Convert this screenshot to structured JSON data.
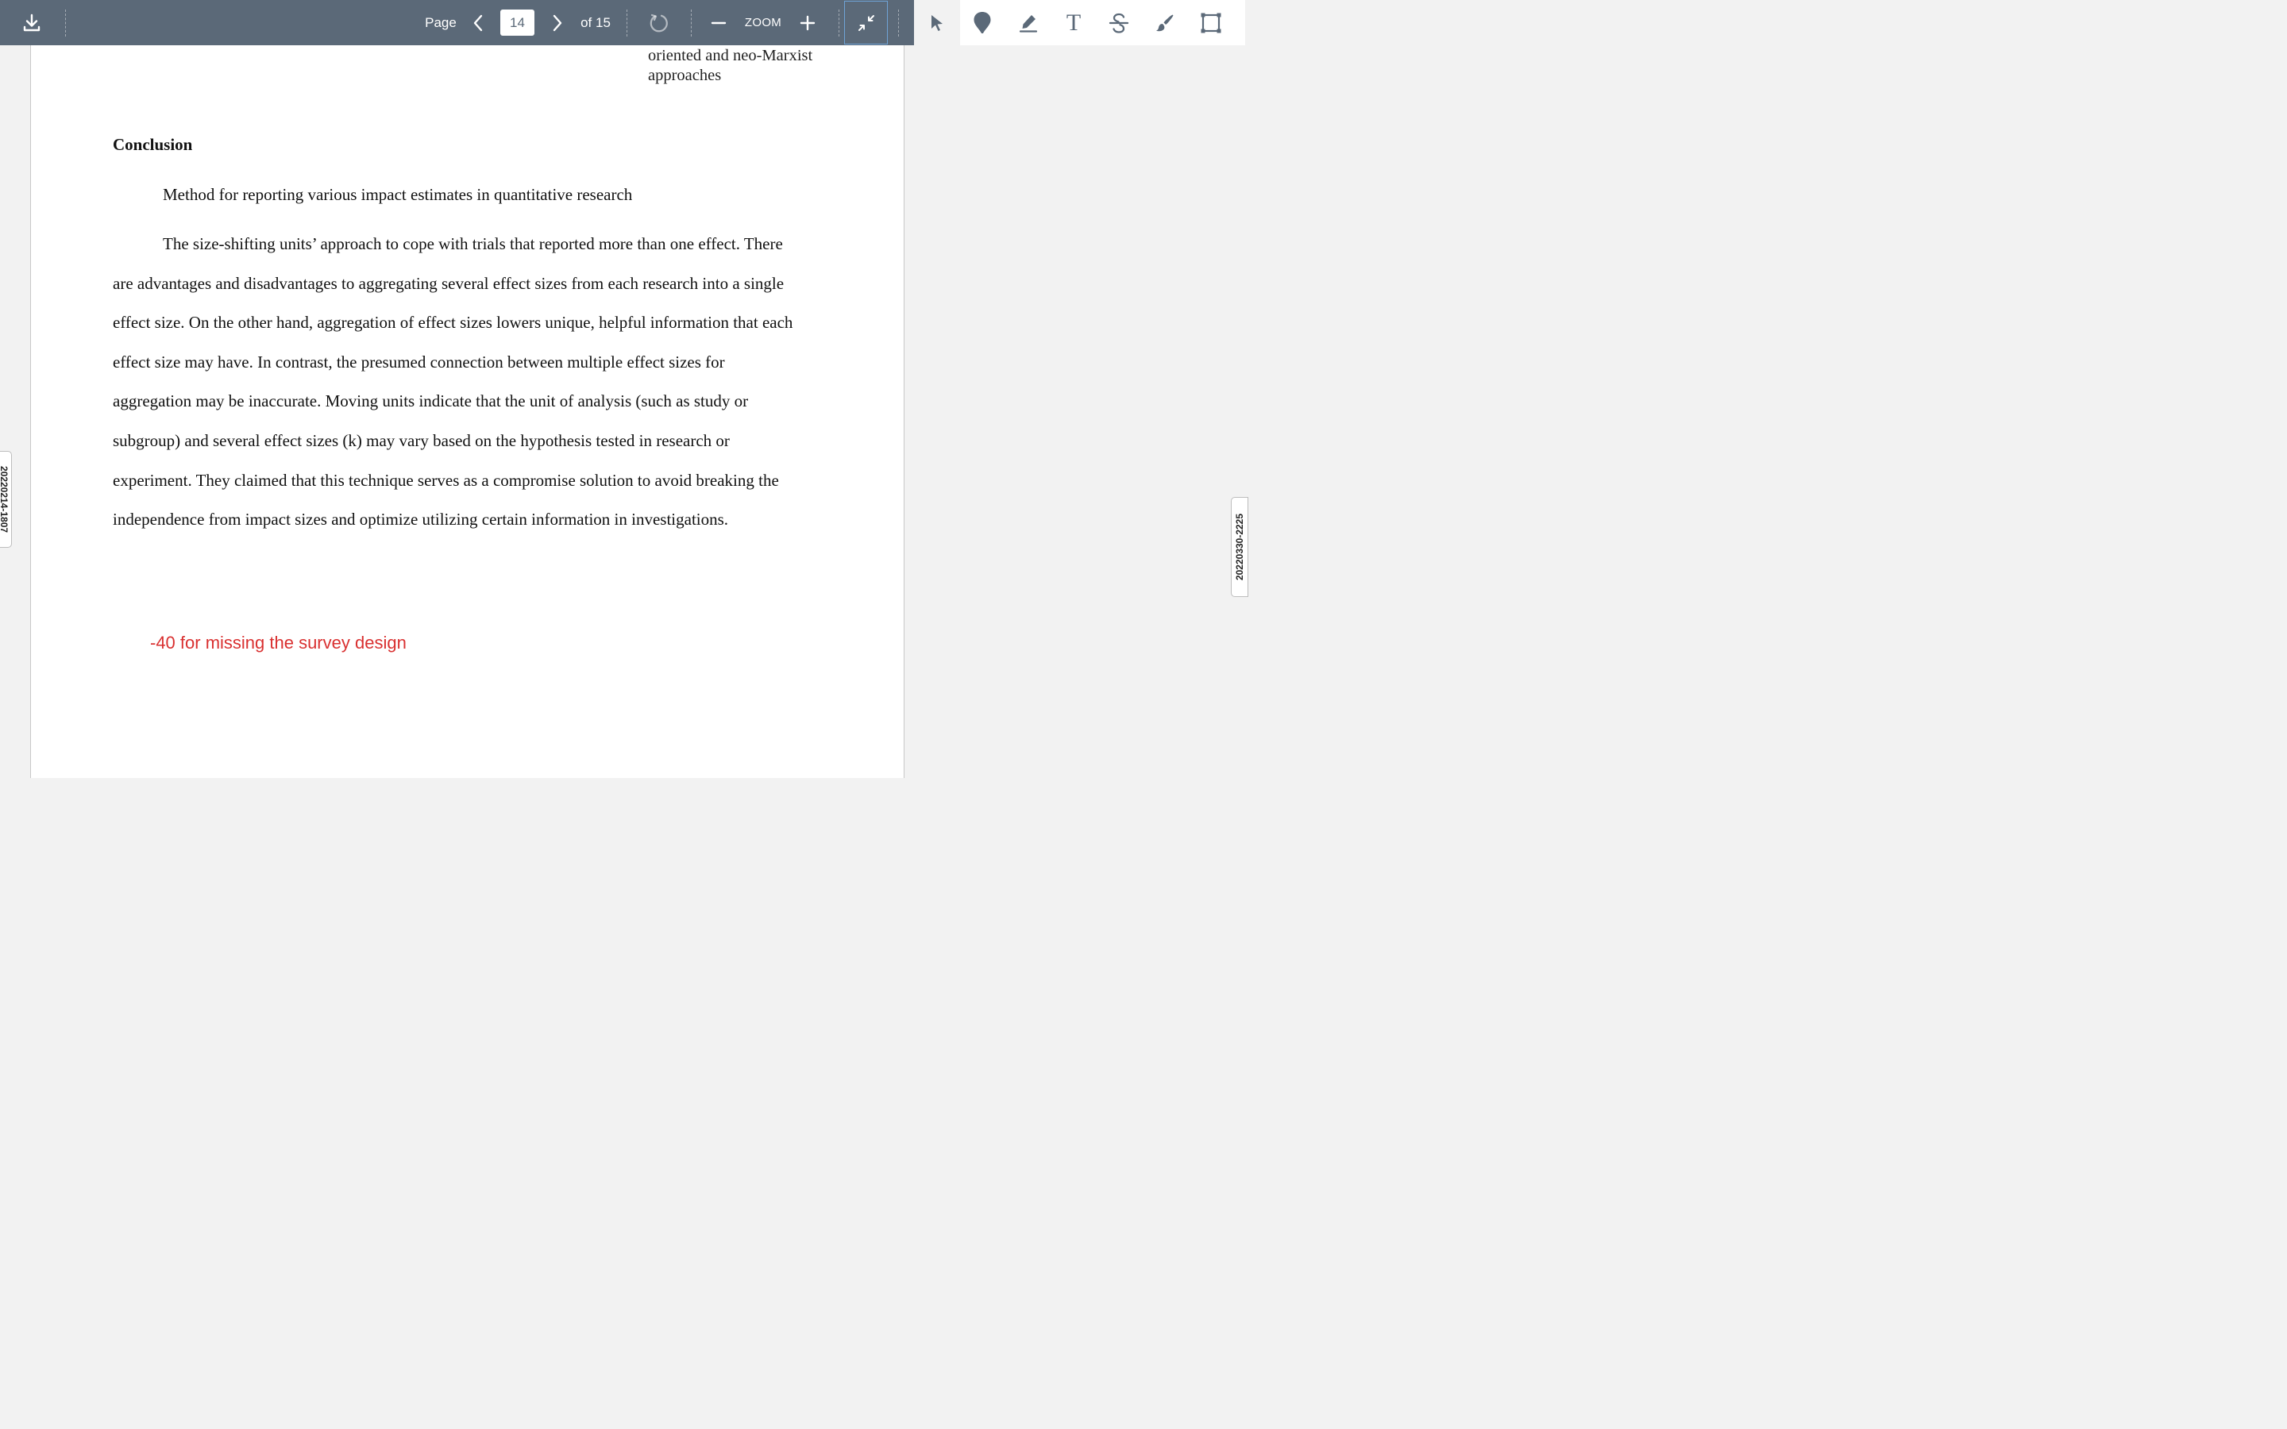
{
  "toolbar": {
    "page_label": "Page",
    "current_page": "14",
    "of_label": "of 15",
    "zoom_label": "ZOOM",
    "icons": {
      "download": "download-icon",
      "prev": "chevron-left-icon",
      "next": "chevron-right-icon",
      "rotate": "rotate-icon",
      "zoom_out": "minus-icon",
      "zoom_in": "plus-icon",
      "fit": "collapse-icon",
      "select": "pointer-icon",
      "pin": "pin-icon",
      "highlight": "highlighter-icon",
      "text": "text-icon",
      "strikeout": "strikethrough-icon",
      "draw": "brush-icon",
      "area": "rectangle-icon"
    },
    "text_tool_glyph": "T"
  },
  "document": {
    "top_cell_lines": [
      "oriented and neo-Marxist",
      "approaches"
    ],
    "heading": "Conclusion",
    "subheading": "Method for reporting various impact estimates in quantitative research",
    "paragraph_lines": [
      " The size-shifting units’ approach to cope with trials that reported more than one effect. There",
      "are advantages and disadvantages to aggregating several effect sizes from each research into a single",
      "effect size. On the other hand, aggregation of effect sizes lowers unique, helpful information that each",
      "effect size may have. In contrast, the presumed connection between multiple effect sizes for",
      "aggregation may be inaccurate. Moving units indicate that the unit of analysis (such as study or",
      "subgroup) and several effect sizes (k) may vary based on the hypothesis tested in research or",
      "experiment. They claimed that this technique serves as a compromise solution to avoid breaking the",
      "independence from impact sizes and optimize utilizing certain information in investigations."
    ],
    "comment": "-40 for missing the survey design"
  },
  "side_tabs": {
    "left": "20220214-1807",
    "right": "20220330-2225"
  },
  "colors": {
    "toolbar_bg": "#5b6978",
    "comment": "#d93030",
    "fit_border": "#6fa3d6"
  }
}
